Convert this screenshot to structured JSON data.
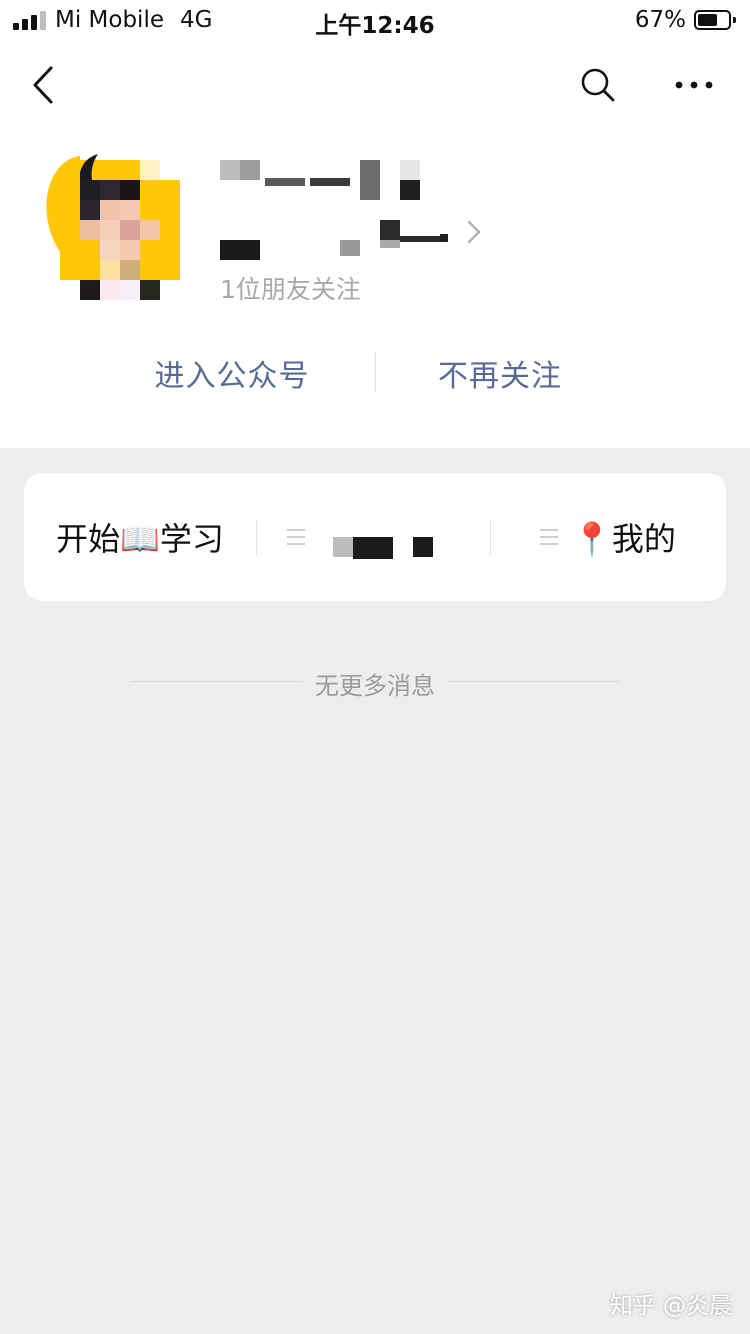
{
  "status_bar": {
    "carrier": "Mi Mobile",
    "network": "4G",
    "time": "上午12:46",
    "battery_percent": "67%",
    "battery_level": 0.67
  },
  "nav": {
    "back_icon": "chevron-left-icon",
    "search_icon": "search-icon",
    "more_icon": "more-icon"
  },
  "profile": {
    "followers_text": "1位朋友关注"
  },
  "actions": {
    "enter": "进入公众号",
    "unfollow": "不再关注"
  },
  "menu": {
    "items": [
      {
        "label": "开始📖学习",
        "has_icon": false
      },
      {
        "label": "",
        "has_icon": true
      },
      {
        "label": "📍我的",
        "has_icon": true
      }
    ]
  },
  "footer": {
    "no_more": "无更多消息"
  },
  "watermark": "知乎 @炎晨",
  "colors": {
    "link": "#576b95",
    "background": "#ededed",
    "avatar_yellow": "#ffc60a"
  }
}
